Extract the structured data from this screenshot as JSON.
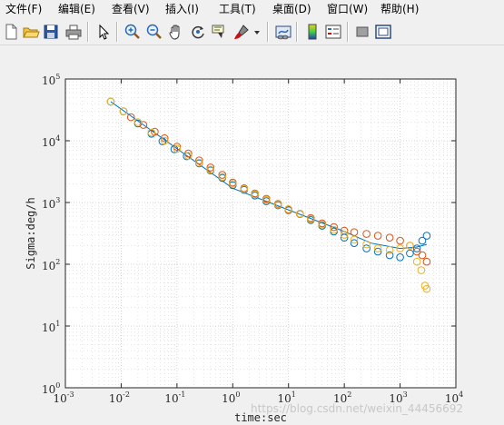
{
  "menubar": {
    "items": [
      {
        "label": "文件(F)"
      },
      {
        "label": "编辑(E)"
      },
      {
        "label": "查看(V)"
      },
      {
        "label": "插入(I)"
      },
      {
        "label": "工具(T)"
      },
      {
        "label": "桌面(D)"
      },
      {
        "label": "窗口(W)"
      },
      {
        "label": "帮助(H)"
      }
    ]
  },
  "toolbar": {
    "icons": [
      "new-file-icon",
      "open-folder-icon",
      "save-icon",
      "print-icon",
      "select-arrow-icon",
      "zoom-in-icon",
      "zoom-out-icon",
      "pan-hand-icon",
      "rotate-3d-icon",
      "data-cursor-icon",
      "brush-icon",
      "dropdown-arrow-icon",
      "link-plot-icon",
      "colorbar-icon",
      "legend-icon",
      "hide-plot-tools-icon",
      "show-plot-tools-icon"
    ]
  },
  "watermark": "https://blog.csdn.net/weixin_44456692",
  "colors": {
    "blue": "#0072bd",
    "orange": "#d95319",
    "yellow": "#edb120",
    "grid": "#d3d3d3"
  },
  "chart_data": {
    "type": "scatter",
    "xlabel": "time:sec",
    "ylabel": "Sigma:deg/h",
    "xscale": "log",
    "yscale": "log",
    "xlim": [
      0.001,
      10000
    ],
    "ylim": [
      1,
      100000
    ],
    "grid": "on (major and minor)",
    "x_ticks": [
      {
        "base": "10",
        "exp": "-3"
      },
      {
        "base": "10",
        "exp": "-2"
      },
      {
        "base": "10",
        "exp": "-1"
      },
      {
        "base": "10",
        "exp": "0"
      },
      {
        "base": "10",
        "exp": "1"
      },
      {
        "base": "10",
        "exp": "2"
      },
      {
        "base": "10",
        "exp": "3"
      },
      {
        "base": "10",
        "exp": "4"
      }
    ],
    "y_ticks": [
      {
        "base": "10",
        "exp": "0"
      },
      {
        "base": "10",
        "exp": "1"
      },
      {
        "base": "10",
        "exp": "2"
      },
      {
        "base": "10",
        "exp": "3"
      },
      {
        "base": "10",
        "exp": "4"
      },
      {
        "base": "10",
        "exp": "5"
      }
    ],
    "fit_line": {
      "color": "#0072bd",
      "x": [
        0.0065,
        1,
        10,
        100,
        300,
        1000,
        2000,
        3000
      ],
      "y": [
        43000,
        1700,
        760,
        340,
        220,
        180,
        190,
        210
      ]
    },
    "series": [
      {
        "color": "#0072bd",
        "x": [
          0.0065,
          0.011,
          0.02,
          0.035,
          0.055,
          0.09,
          0.15,
          0.25,
          0.4,
          0.65,
          1.0,
          1.6,
          2.5,
          4,
          6.5,
          10,
          16,
          25,
          40,
          65,
          100,
          150,
          250,
          400,
          650,
          1000,
          1500,
          2000,
          2500,
          3000
        ],
        "y": [
          43000,
          30000,
          19000,
          13000,
          9800,
          7300,
          5600,
          4300,
          3300,
          2500,
          1900,
          1600,
          1300,
          1050,
          900,
          750,
          650,
          520,
          420,
          340,
          270,
          220,
          180,
          160,
          140,
          130,
          150,
          180,
          240,
          290
        ]
      },
      {
        "color": "#d95319",
        "x": [
          0.015,
          0.025,
          0.04,
          0.06,
          0.1,
          0.16,
          0.25,
          0.4,
          0.65,
          1.0,
          1.6,
          2.5,
          4,
          6.5,
          10,
          16,
          25,
          40,
          65,
          100,
          150,
          250,
          400,
          650,
          1000,
          1500,
          2000,
          2500,
          3000
        ],
        "y": [
          24000,
          18000,
          14000,
          11000,
          8000,
          6200,
          4800,
          3700,
          2800,
          2100,
          1700,
          1400,
          1150,
          950,
          760,
          660,
          560,
          460,
          400,
          350,
          330,
          310,
          290,
          270,
          240,
          200,
          160,
          140,
          110
        ]
      },
      {
        "color": "#edb120",
        "x": [
          0.0065,
          0.011,
          0.02,
          0.035,
          0.06,
          0.1,
          0.16,
          0.25,
          0.4,
          0.65,
          1.0,
          1.6,
          2.5,
          4,
          6.5,
          10,
          16,
          25,
          40,
          65,
          100,
          150,
          250,
          400,
          650,
          1000,
          1500,
          2000,
          2400,
          2800,
          3000
        ],
        "y": [
          43000,
          30000,
          20000,
          13500,
          10000,
          7400,
          5700,
          4400,
          3400,
          2600,
          2000,
          1650,
          1350,
          1100,
          920,
          780,
          660,
          540,
          440,
          360,
          300,
          250,
          210,
          180,
          170,
          180,
          200,
          110,
          80,
          45,
          40
        ]
      }
    ]
  }
}
